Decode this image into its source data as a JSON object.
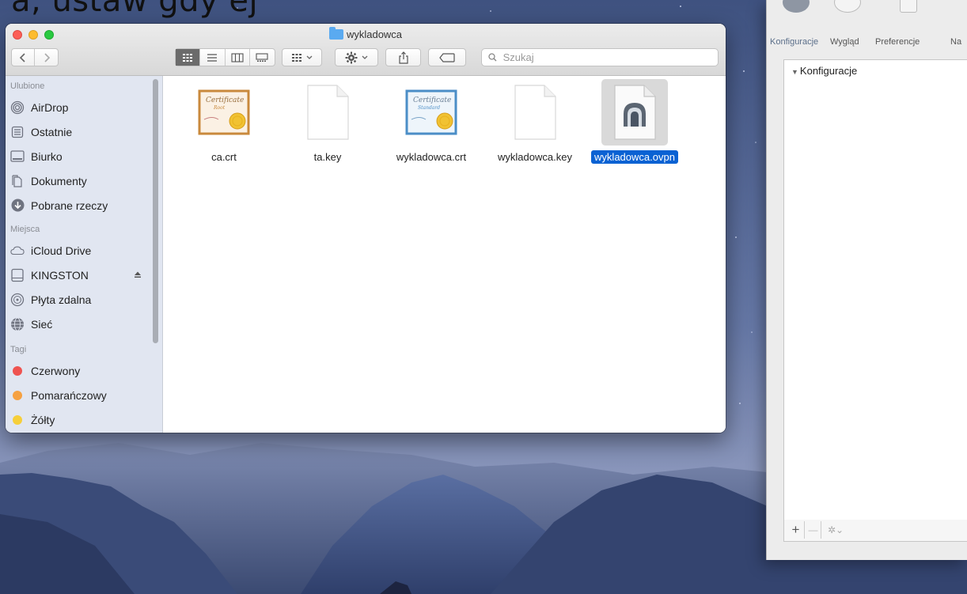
{
  "cropped_header": {
    "text": "a, ustaw gdy ej"
  },
  "finder": {
    "title": "wykladowca",
    "search_placeholder": "Szukaj",
    "toolbar": {
      "back_icon": "chevron-left-icon",
      "forward_icon": "chevron-right-icon"
    },
    "sidebar": {
      "sections": [
        {
          "title": "Ulubione",
          "items": [
            {
              "label": "AirDrop",
              "icon": "airdrop-icon"
            },
            {
              "label": "Ostatnie",
              "icon": "recents-icon"
            },
            {
              "label": "Biurko",
              "icon": "desktop-icon"
            },
            {
              "label": "Dokumenty",
              "icon": "documents-icon"
            },
            {
              "label": "Pobrane rzeczy",
              "icon": "downloads-icon"
            }
          ]
        },
        {
          "title": "Miejsca",
          "items": [
            {
              "label": "iCloud Drive",
              "icon": "cloud-icon"
            },
            {
              "label": "KINGSTON",
              "icon": "drive-icon",
              "eject": true
            },
            {
              "label": "Płyta zdalna",
              "icon": "disc-icon"
            },
            {
              "label": "Sieć",
              "icon": "network-icon"
            }
          ]
        },
        {
          "title": "Tagi",
          "items": [
            {
              "label": "Czerwony",
              "color": "#ef5350"
            },
            {
              "label": "Pomarańczowy",
              "color": "#f5a142"
            },
            {
              "label": "Żółty",
              "color": "#f6cf3a"
            }
          ]
        }
      ]
    },
    "files": [
      {
        "name": "ca.crt",
        "type": "certificate-root",
        "selected": false
      },
      {
        "name": "ta.key",
        "type": "blank",
        "selected": false
      },
      {
        "name": "wykladowca.crt",
        "type": "certificate-standard",
        "selected": false
      },
      {
        "name": "wykladowca.key",
        "type": "blank",
        "selected": false
      },
      {
        "name": "wykladowca.ovpn",
        "type": "ovpn",
        "selected": true
      }
    ]
  },
  "panel": {
    "tabs": [
      {
        "label": "Konfiguracje",
        "active": true
      },
      {
        "label": "Wygląd",
        "active": false
      },
      {
        "label": "Preferencje",
        "active": false
      },
      {
        "label": "Na",
        "active": false
      }
    ],
    "list_header": "Konfiguracje",
    "add_label": "+",
    "remove_label": "—",
    "gear_label": "✲⌄"
  },
  "colors": {
    "selection": "#0a62d3",
    "sidebar_bg": "#e1e6f1",
    "close": "#fc5f57",
    "minimize": "#fdbc2e",
    "maximize": "#29c940"
  }
}
